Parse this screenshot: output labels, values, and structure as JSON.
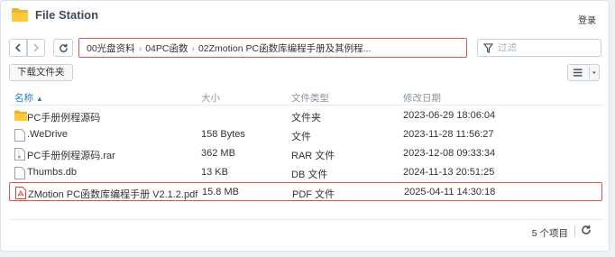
{
  "app": {
    "title": "File Station",
    "login_label": "登录"
  },
  "path": {
    "segments": [
      "00光盘资料",
      "04PC函数",
      "02Zmotion PC函数库编程手册及其例程..."
    ]
  },
  "filter": {
    "placeholder": "过滤"
  },
  "actions": {
    "download_label": "下载文件夹"
  },
  "table": {
    "headers": {
      "name": "名称",
      "size": "大小",
      "type": "文件类型",
      "date": "修改日期"
    },
    "rows": [
      {
        "name": "PC手册例程源码",
        "size": "",
        "type": "文件夹",
        "date": "2023-06-29 18:06:04",
        "icon": "folder-icon"
      },
      {
        "name": ".WeDrive",
        "size": "158 Bytes",
        "type": "文件",
        "date": "2023-11-28 11:56:27",
        "icon": "file-icon"
      },
      {
        "name": "PC手册例程源码.rar",
        "size": "362 MB",
        "type": "RAR 文件",
        "date": "2023-12-08 09:33:34",
        "icon": "archive-icon"
      },
      {
        "name": "Thumbs.db",
        "size": "13 KB",
        "type": "DB 文件",
        "date": "2024-11-13 20:51:25",
        "icon": "file-icon"
      },
      {
        "name": "ZMotion PC函数库编程手册 V2.1.2.pdf",
        "size": "15.8 MB",
        "type": "PDF 文件",
        "date": "2025-04-11 14:30:18",
        "icon": "pdf-icon"
      }
    ]
  },
  "footer": {
    "item_count": "5 个项目"
  },
  "colors": {
    "folder": "#f5b31b",
    "accent": "#2a7dcf",
    "highlight": "#d9534f",
    "pdf": "#e0453a"
  }
}
